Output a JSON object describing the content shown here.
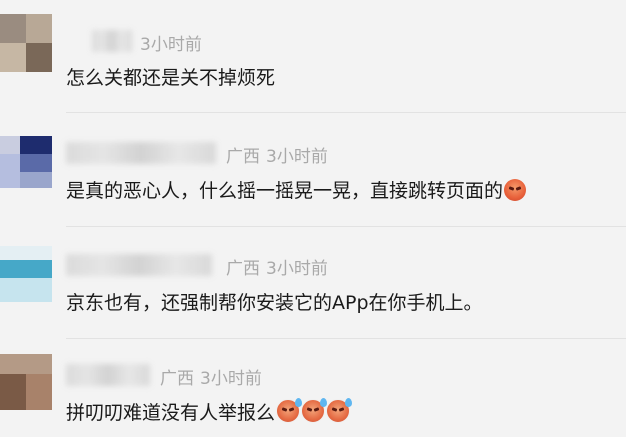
{
  "comments": [
    {
      "location": "",
      "time": "3小时前",
      "text": "怎么关都还是关不掉烦死",
      "avatar_colors": [
        "#8a7a6a",
        "#b0a090",
        "#c8b8a0",
        "#6a5a4a"
      ]
    },
    {
      "location": "广西",
      "time": "3小时前",
      "text": "是真的恶心人，什么摇一摇晃一晃，直接跳转页面的",
      "emoji": "angry-emoji",
      "avatar_colors": [
        "#2a3a7a",
        "#6a7ab0",
        "#9aa8d0",
        "#d0d4e8"
      ]
    },
    {
      "location": "广西",
      "time": "3小时前",
      "text": "京东也有，还强制帮你安装它的APp在你手机上。",
      "avatar_colors": [
        "#3aa0c0",
        "#7ac4dc",
        "#bfe3ee",
        "#e6f3f8"
      ]
    },
    {
      "location": "广西",
      "time": "3小时前",
      "text": "拼叨叨难道没有人举报么",
      "emoji": "sweat-emoji",
      "avatar_colors": [
        "#6a4a3a",
        "#a07a60",
        "#c9a88a",
        "#8a6a55"
      ]
    }
  ],
  "colors": {
    "background": "#f3f3f3",
    "meta_text": "#a9a9a9",
    "content_text": "#1a1a1a"
  }
}
